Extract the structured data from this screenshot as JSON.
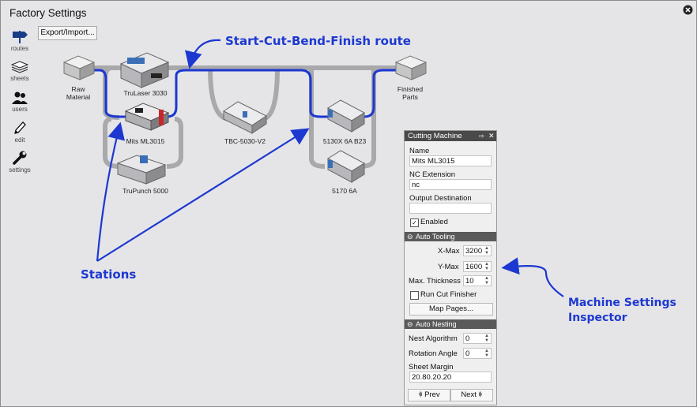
{
  "window": {
    "title": "Factory Settings"
  },
  "nav": [
    {
      "label": "routes"
    },
    {
      "label": "sheets"
    },
    {
      "label": "users"
    },
    {
      "label": "edit"
    },
    {
      "label": "settings"
    }
  ],
  "toolbar": {
    "export_label": "Export/Import..."
  },
  "stations": {
    "raw": "Raw\nMaterial",
    "trulaser": "TruLaser 3030",
    "mits": "Mits ML3015",
    "trupunch": "TruPunch 5000",
    "tbc": "TBC-5030-V2",
    "b23": "5130X 6A B23",
    "s5170": "5170 6A",
    "finished": "Finished\nParts"
  },
  "callouts": {
    "route": "Start-Cut-Bend-Finish route",
    "stations": "Stations",
    "inspector": "Machine Settings\nInspector"
  },
  "colors": {
    "route": "#1c38d0",
    "callout": "#1c38d0",
    "panel_header": "#4a4a4a"
  },
  "inspector": {
    "title": "Cutting Machine",
    "name_label": "Name",
    "name_value": "Mits ML3015",
    "nc_label": "NC Extension",
    "nc_value": "nc",
    "output_label": "Output Destination",
    "output_value": "",
    "enabled_label": "Enabled",
    "auto_tooling": {
      "header": "Auto Tooling",
      "xmax_label": "X-Max",
      "xmax_value": "3200",
      "ymax_label": "Y-Max",
      "ymax_value": "1600",
      "thickness_label": "Max. Thickness",
      "thickness_value": "10",
      "run_cut_label": "Run Cut Finisher",
      "map_pages_label": "Map Pages..."
    },
    "auto_nesting": {
      "header": "Auto Nesting",
      "nest_label": "Nest Algorithm",
      "nest_value": "0",
      "rotation_label": "Rotation Angle",
      "rotation_value": "0",
      "margin_label": "Sheet Margin",
      "margin_value": "20.80.20.20"
    },
    "prev_label": "Prev",
    "next_label": "Next"
  }
}
